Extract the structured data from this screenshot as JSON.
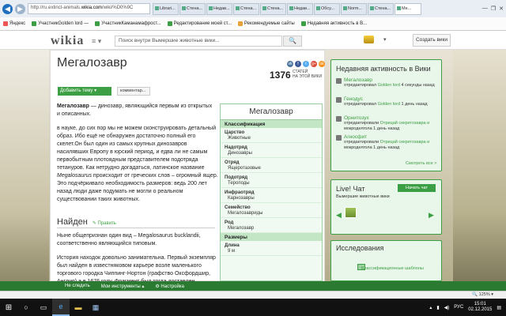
{
  "browser": {
    "url_prefix": "http://ru.extinct-animals.",
    "url_host": "wikia.com",
    "url_rest": "/wiki/%D0%9C",
    "tabs": [
      {
        "label": "Librari..."
      },
      {
        "label": "Стена..."
      },
      {
        "label": "Недав..."
      },
      {
        "label": "Стена..."
      },
      {
        "label": "Стена..."
      },
      {
        "label": "Недав..."
      },
      {
        "label": "Обсу..."
      },
      {
        "label": "Norm..."
      },
      {
        "label": "Стена..."
      },
      {
        "label": "Ме..."
      }
    ],
    "window_buttons": [
      "—",
      "❐",
      "✕",
      "⌂",
      "☆",
      "⚙"
    ],
    "favorites": [
      {
        "label": "Яндекс"
      },
      {
        "label": "УчастникGolden lord —"
      },
      {
        "label": "УчастникКаманамафрост..."
      },
      {
        "label": "Редактирование моей ст..."
      },
      {
        "label": "Рекомендуемые сайты"
      },
      {
        "label": "Недавняя активность в В..."
      }
    ]
  },
  "header": {
    "logo": "wikia",
    "menu_icon": "≡ ▾",
    "search_placeholder": "Поиск внутри Вымершие животные вики...",
    "search_icon": "🔍",
    "user_arrow": "▾",
    "create_wiki": "Создать вики"
  },
  "article": {
    "title": "Мегалозавр",
    "share": [
      "vk",
      "f",
      "t",
      "g+",
      "ok"
    ],
    "count": "1376",
    "count_label_line1": "СТАТЕЙ",
    "count_label_line2": "НА ЭТОЙ ВИКИ",
    "add_theme": "Добавить тему",
    "comment_btn": "комментар...",
    "intro_bold": "Мегалозавр",
    "intro_rest": " — динозавр, являющийся первым из открытых и описанных.",
    "para1_a": "в науке, до сих пор мы не можем сконструировать детальный образ. Ибо ещё не обнаружен достаточно полный его скелет.Он был один из самых крупных динозавров насилявших Европу в юрский период, и едва ли не самым первобытным плотоядным представителем подотряда тетануров. Как нетрудно догадаться, латинское название ",
    "para1_italic": "Megalosaurus",
    "para1_b": " происходит от греческих слов – огромный ящер. Это подчёркивало необходимость размеров: ведь 200 лет назад люди даже подумать не могли о реальном существовании таких животных.",
    "section": "Найден",
    "edit": "✎ Править",
    "para2": "Ныне общепризнан один вид – Megalosaurus bucklandii, соответственно являющийся типовым.",
    "para3": "История находок довольно занимательна. Первый экземпляр был найден в известняковом карьере возле маленького торгового городка Чиппинг-Нортон (графство Оксфордшир, Англия) а в 1676 году. Фрагмент был тогда доставлен"
  },
  "infobox": {
    "title": "Мегалозавр",
    "classification": "Классификация",
    "rows": [
      {
        "label": "Царство",
        "value": "Животные"
      },
      {
        "label": "Надотряд",
        "value": "Динозавры"
      },
      {
        "label": "Отряд",
        "value": "Ящеротазовые"
      },
      {
        "label": "Подотряд",
        "value": "Тероподы"
      },
      {
        "label": "Инфраотряд",
        "value": "Карнозавры"
      },
      {
        "label": "Семейство",
        "value": "Мегалозавриды"
      },
      {
        "label": "Род",
        "value": "Мегалозавр"
      }
    ],
    "sizes": "Размеры",
    "length_label": "Длина",
    "length_value": "9 м"
  },
  "rail": {
    "title": "Недавняя активность в Вики",
    "items": [
      {
        "name": "Мегалозавр",
        "meta_a": "отредактировал ",
        "user": "Golden lord",
        "meta_b": " 4 секунды назад",
        "meta_c": ""
      },
      {
        "name": "Генодус",
        "meta_a": "отредактировал ",
        "user": "Golden lord",
        "meta_b": " 1 день назад",
        "meta_c": ""
      },
      {
        "name": "Орнитозух",
        "meta_a": "отредактировали ",
        "user": "Отрицай секретозавра и",
        "meta_b": "",
        "meta_c": "мокроделгола 1 день назад"
      },
      {
        "name": "Агносфит",
        "meta_a": "отредактировали ",
        "user": "Отрицай секретозавра и",
        "meta_b": "",
        "meta_c": "мокроделгола 1 день назад"
      }
    ],
    "see_all": "Смотреть все >",
    "chat_title": "Live! Чат",
    "chat_btn": "Начать чат",
    "chat_sub": "Вымершие животные вики",
    "chat_prev": "◀",
    "chat_next": "▶",
    "explore_title": "Исследования",
    "templates_link": "Классификационные шаблоны"
  },
  "wikibar": {
    "follow": "Не следить",
    "tools": "Мои инструменты",
    "settings": "Настройка"
  },
  "statusbar": {
    "zoom": "🔍 125% ▾"
  },
  "taskbar": {
    "start": "⊞",
    "search": "○",
    "taskview": "▭",
    "ie": "e",
    "explorer": "▬",
    "store": "▦",
    "lang": "РУС",
    "time": "15:01",
    "date": "02.12.2015"
  },
  "colors": {
    "wikia_green": "#3c9f43",
    "wikibar_green": "#2a7b31",
    "ie_blue": "#1f6fbf"
  }
}
